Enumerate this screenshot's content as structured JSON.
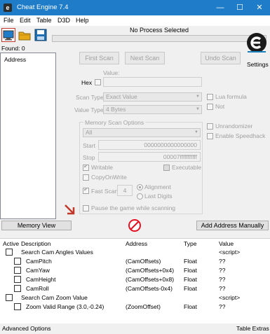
{
  "window": {
    "title": "Cheat Engine 7.4",
    "icon_letter": "e",
    "minimize": "—",
    "maximize": "☐",
    "close": "✕"
  },
  "menu": [
    "File",
    "Edit",
    "Table",
    "D3D",
    "Help"
  ],
  "toolbar": {
    "process_label": "No Process Selected",
    "icons": [
      "open-process-icon",
      "open-file-icon",
      "save-icon"
    ]
  },
  "found": "Found: 0",
  "results": {
    "header": "Address"
  },
  "scan": {
    "first_scan": "First Scan",
    "next_scan": "Next Scan",
    "undo_scan": "Undo Scan",
    "settings": "Settings",
    "value_label": "Value:",
    "hex_label": "Hex",
    "scan_type_label": "Scan Type",
    "scan_type_value": "Exact Value",
    "value_type_label": "Value Type",
    "value_type_value": "4 Bytes",
    "lua_formula": "Lua formula",
    "not_label": "Not",
    "unrandomizer": "Unrandomizer",
    "enable_speedhack": "Enable Speedhack"
  },
  "memory_options": {
    "title": "Memory Scan Options",
    "region": "All",
    "start_label": "Start",
    "start_value": "0000000000000000",
    "stop_label": "Stop",
    "stop_value": "00007fffffffffff",
    "writable": "Writable",
    "executable": "Executable",
    "copy_on_write": "CopyOnWrite",
    "fast_scan": "Fast Scan",
    "fast_scan_value": "4",
    "alignment": "Alignment",
    "last_digits": "Last Digits",
    "pause_game": "Pause the game while scanning"
  },
  "buttons": {
    "memory_view": "Memory View",
    "add_address": "Add Address Manually"
  },
  "table": {
    "columns": [
      "Active",
      "Description",
      "Address",
      "Type",
      "Value"
    ],
    "rows": [
      {
        "description": "Search Cam Angles Values",
        "address": "",
        "type": "",
        "value": "<script>",
        "indent": 0
      },
      {
        "description": "CamPitch",
        "address": "(CamOffsets)",
        "type": "Float",
        "value": "??",
        "indent": 1
      },
      {
        "description": "CamYaw",
        "address": "(CamOffsets+0x4)",
        "type": "Float",
        "value": "??",
        "indent": 1
      },
      {
        "description": "CamHeight",
        "address": "(CamOffsets+0x8)",
        "type": "Float",
        "value": "??",
        "indent": 1
      },
      {
        "description": "CamRoll",
        "address": "(CamOffsets-0x4)",
        "type": "Float",
        "value": "??",
        "indent": 1
      },
      {
        "description": "Search Cam Zoom Value",
        "address": "",
        "type": "",
        "value": "<script>",
        "indent": 0
      },
      {
        "description": "Zoom Valid Range (3.0,-0.24)",
        "address": "(ZoomOffset)",
        "type": "Float",
        "value": "??",
        "indent": 1
      }
    ]
  },
  "status": {
    "left": "Advanced Options",
    "right": "Table Extras"
  },
  "colors": {
    "titlebar": "#1e7cc8",
    "window_bg": "#f0f0f0",
    "accent": "#e81123"
  }
}
